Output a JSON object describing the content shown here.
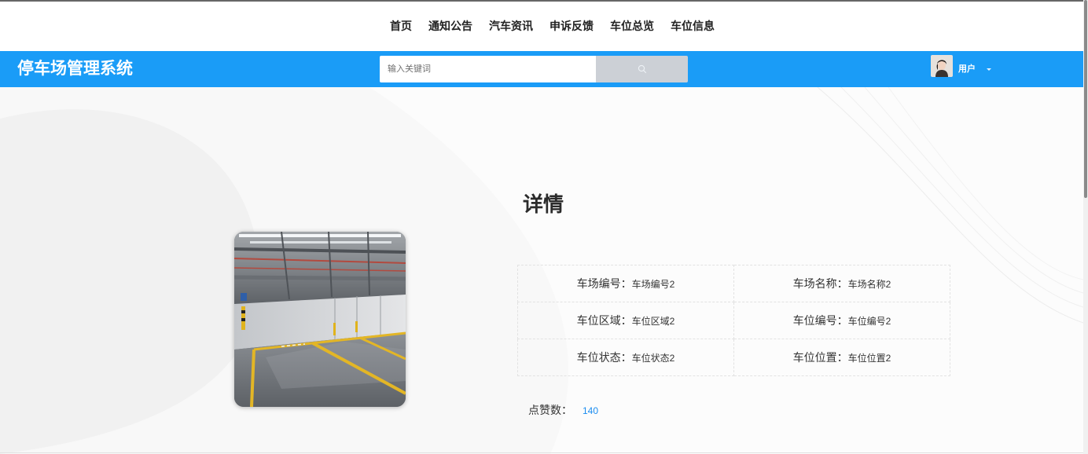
{
  "colors": {
    "header_background": "#1a9cf7",
    "likes_value": "#1a8cf0",
    "search_button": "#ccd0d6"
  },
  "nav": {
    "links": [
      "首页",
      "通知公告",
      "汽车资讯",
      "申诉反馈",
      "车位总览",
      "车位信息"
    ]
  },
  "header": {
    "title": "停车场管理系统",
    "search": {
      "placeholder": "输入关键词",
      "button_icon": "search-icon"
    },
    "user": {
      "name": "用户",
      "avatar_icon": "avatar",
      "dropdown_icon": "caret-down-icon"
    }
  },
  "detail": {
    "heading": "详情",
    "image_icon": "parking-space-photo",
    "fields": [
      {
        "label": "车场编号：",
        "value": "车场编号2"
      },
      {
        "label": "车场名称：",
        "value": "车场名称2"
      },
      {
        "label": "车位区域：",
        "value": "车位区域2"
      },
      {
        "label": "车位编号：",
        "value": "车位编号2"
      },
      {
        "label": "车位状态：",
        "value": "车位状态2"
      },
      {
        "label": "车位位置：",
        "value": "车位位置2"
      }
    ],
    "likes": {
      "label": "点赞数：",
      "value": 140
    }
  }
}
